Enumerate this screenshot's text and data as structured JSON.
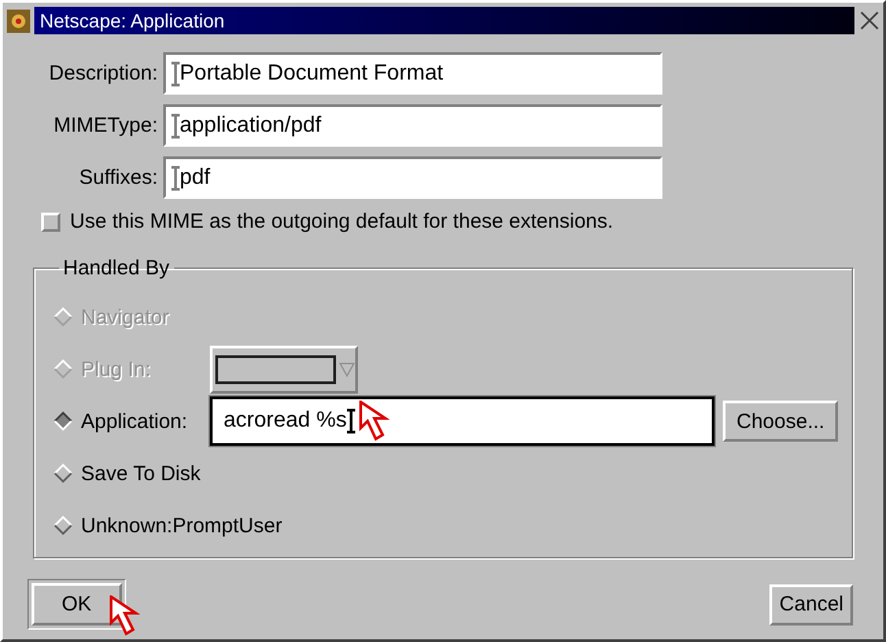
{
  "window": {
    "title": "Netscape: Application"
  },
  "fields": [
    {
      "label": "Description:",
      "value": "Portable Document Format"
    },
    {
      "label": "MIMEType:",
      "value": "application/pdf"
    },
    {
      "label": "Suffixes:",
      "value": "pdf"
    }
  ],
  "default_checkbox": {
    "label": "Use this MIME as the outgoing default for these extensions.",
    "checked": false
  },
  "handled_by": {
    "title": "Handled By",
    "options": [
      {
        "kind": "plain",
        "label": "Navigator",
        "selected": false,
        "disabled": true
      },
      {
        "kind": "dropdown",
        "label": "Plug In:",
        "selected": false,
        "disabled": true
      },
      {
        "kind": "command",
        "label": "Application:",
        "selected": true,
        "disabled": false,
        "value": "acroread %s",
        "button": "Choose..."
      },
      {
        "kind": "plain",
        "label": "Save To Disk",
        "selected": false,
        "disabled": false
      },
      {
        "kind": "plain",
        "label": "Unknown:PromptUser",
        "selected": false,
        "disabled": false
      }
    ]
  },
  "buttons": [
    {
      "label": "OK",
      "default": true
    },
    {
      "label": "Cancel",
      "default": false
    }
  ]
}
